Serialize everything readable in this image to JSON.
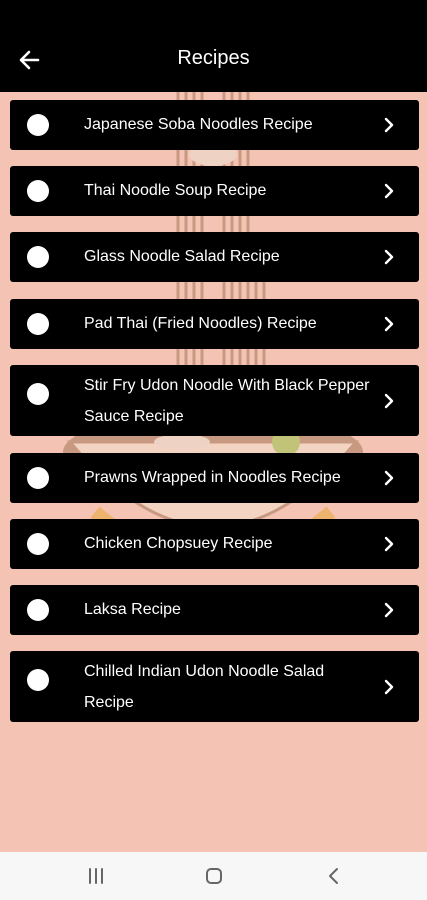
{
  "app_bar": {
    "title": "Recipes"
  },
  "recipes": [
    {
      "label": "Japanese Soba Noodles Recipe"
    },
    {
      "label": "Thai Noodle Soup Recipe"
    },
    {
      "label": "Glass Noodle Salad Recipe"
    },
    {
      "label": "Pad Thai (Fried Noodles) Recipe"
    },
    {
      "label": "Stir Fry Udon Noodle With Black Pepper Sauce Recipe"
    },
    {
      "label": "Prawns Wrapped in Noodles Recipe"
    },
    {
      "label": "Chicken Chopsuey Recipe"
    },
    {
      "label": "Laksa Recipe"
    },
    {
      "label": "Chilled Indian Udon Noodle Salad Recipe"
    }
  ],
  "colors": {
    "background": "#f5c3b3",
    "bar": "#000000",
    "row": "#000000",
    "text": "#ffffff"
  },
  "icons": {
    "back": "arrow-left-icon",
    "chevron": "chevron-right-icon",
    "bullet": "circle-icon"
  }
}
